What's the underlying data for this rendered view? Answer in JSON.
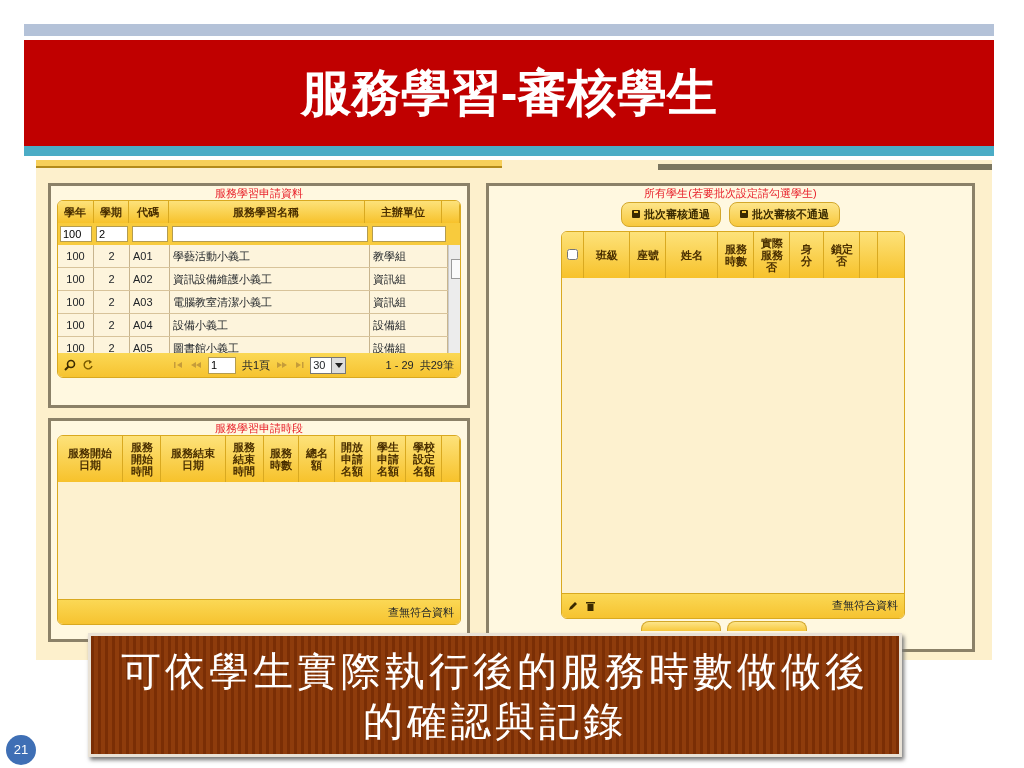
{
  "slide": {
    "title": "服務學習-審核學生",
    "caption": "可依學生實際執行後的服務時數做做後的確認與記錄",
    "page_number": "21"
  },
  "applications": {
    "title": "服務學習申請資料",
    "columns": [
      "學年",
      "學期",
      "代碼",
      "服務學習名稱",
      "主辦單位"
    ],
    "filters": [
      "100",
      "2"
    ],
    "rows": [
      [
        "100",
        "2",
        "A01",
        "學藝活動小義工",
        "教學組"
      ],
      [
        "100",
        "2",
        "A02",
        "資訊設備維護小義工",
        "資訊組"
      ],
      [
        "100",
        "2",
        "A03",
        "電腦教室清潔小義工",
        "資訊組"
      ],
      [
        "100",
        "2",
        "A04",
        "設備小義工",
        "設備組"
      ],
      [
        "100",
        "2",
        "A05",
        "圖書館小義工",
        "設備組"
      ]
    ],
    "pager": {
      "page": "1",
      "total_pages": "共1頁",
      "page_size": "30",
      "range": "1 - 29",
      "total": "共29筆"
    }
  },
  "sessions": {
    "title": "服務學習申請時段",
    "columns": [
      "服務開始日期",
      "服務開始時間",
      "服務結束日期",
      "服務結束時間",
      "服務時數",
      "總名額",
      "開放申請名額",
      "學生申請名額",
      "學校設定名額"
    ],
    "empty_text": "查無符合資料"
  },
  "students": {
    "title": "所有學生(若要批次設定請勾選學生)",
    "buttons": [
      "批次審核通過",
      "批次審核不通過"
    ],
    "select_all": {
      "checked": false
    },
    "columns": [
      "班級",
      "座號",
      "姓名",
      "服務時數",
      "實際服務否",
      "身分",
      "鎖定否"
    ],
    "empty_text": "查無符合資料"
  }
}
